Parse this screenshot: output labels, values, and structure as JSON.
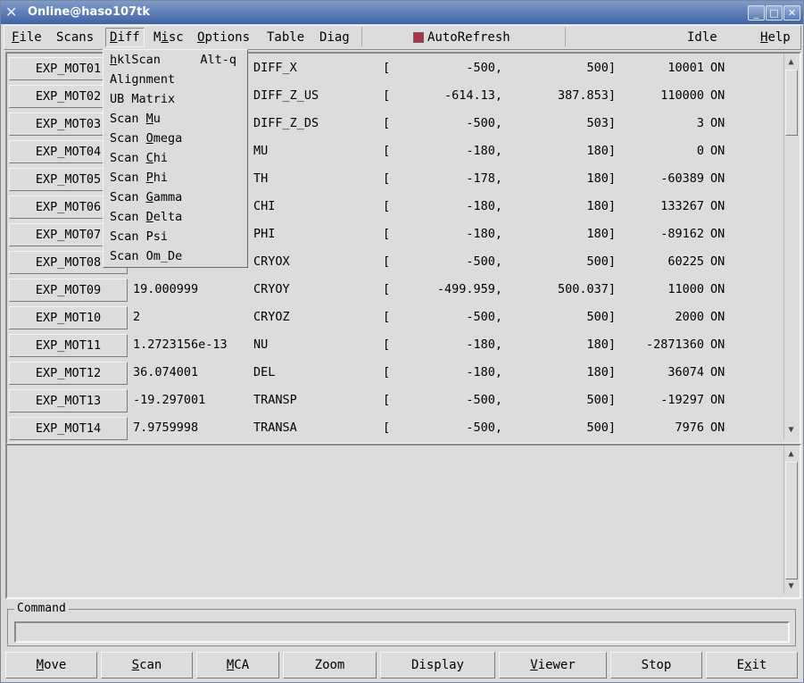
{
  "window": {
    "title": "Online@haso107tk",
    "controls": {
      "minimize": "_",
      "maximize": "□",
      "close": "✕"
    }
  },
  "menubar": {
    "items": [
      "File",
      "Scans",
      "Diff",
      "Misc",
      "Options",
      "Table",
      "Diag"
    ],
    "autorefresh_label": "AutoRefresh",
    "status": "Idle",
    "help": "Help"
  },
  "diff_menu": {
    "items": [
      {
        "label": "hklScan",
        "accel": "Alt-q"
      },
      {
        "label": "Alignment",
        "accel": ""
      },
      {
        "label": "UB Matrix",
        "accel": ""
      },
      {
        "label": "Scan Mu",
        "accel": ""
      },
      {
        "label": "Scan Omega",
        "accel": ""
      },
      {
        "label": "Scan Chi",
        "accel": ""
      },
      {
        "label": "Scan Phi",
        "accel": ""
      },
      {
        "label": "Scan Gamma",
        "accel": ""
      },
      {
        "label": "Scan Delta",
        "accel": ""
      },
      {
        "label": "Scan Psi",
        "accel": ""
      },
      {
        "label": "Scan Om_De",
        "accel": ""
      }
    ]
  },
  "motors": [
    {
      "name": "EXP_MOT01",
      "position": "",
      "alias": "DIFF_X",
      "bracket": "[",
      "min": "-500,",
      "max": "500]",
      "steps": "10001",
      "state": "ON"
    },
    {
      "name": "EXP_MOT02",
      "position": "",
      "alias": "DIFF_Z_US",
      "bracket": "[",
      "min": "-614.13,",
      "max": "387.853]",
      "steps": "110000",
      "state": "ON"
    },
    {
      "name": "EXP_MOT03",
      "position": "",
      "alias": "DIFF_Z_DS",
      "bracket": "[",
      "min": "-500,",
      "max": "503]",
      "steps": "3",
      "state": "ON"
    },
    {
      "name": "EXP_MOT04",
      "position": "",
      "alias": "MU",
      "bracket": "[",
      "min": "-180,",
      "max": "180]",
      "steps": "0",
      "state": "ON"
    },
    {
      "name": "EXP_MOT05",
      "position": "",
      "alias": "TH",
      "bracket": "[",
      "min": "-178,",
      "max": "180]",
      "steps": "-60389",
      "state": "ON"
    },
    {
      "name": "EXP_MOT06",
      "position": "",
      "alias": "CHI",
      "bracket": "[",
      "min": "-180,",
      "max": "180]",
      "steps": "133267",
      "state": "ON"
    },
    {
      "name": "EXP_MOT07",
      "position": "",
      "alias": "PHI",
      "bracket": "[",
      "min": "-180,",
      "max": "180]",
      "steps": "-89162",
      "state": "ON"
    },
    {
      "name": "EXP_MOT08",
      "position": "",
      "alias": "CRYOX",
      "bracket": "[",
      "min": "-500,",
      "max": "500]",
      "steps": "60225",
      "state": "ON"
    },
    {
      "name": "EXP_MOT09",
      "position": "19.000999",
      "alias": "CRYOY",
      "bracket": "[",
      "min": "-499.959,",
      "max": "500.037]",
      "steps": "11000",
      "state": "ON"
    },
    {
      "name": "EXP_MOT10",
      "position": "2",
      "alias": "CRYOZ",
      "bracket": "[",
      "min": "-500,",
      "max": "500]",
      "steps": "2000",
      "state": "ON"
    },
    {
      "name": "EXP_MOT11",
      "position": "1.2723156e-13",
      "alias": "NU",
      "bracket": "[",
      "min": "-180,",
      "max": "180]",
      "steps": "-2871360",
      "state": "ON"
    },
    {
      "name": "EXP_MOT12",
      "position": "36.074001",
      "alias": "DEL",
      "bracket": "[",
      "min": "-180,",
      "max": "180]",
      "steps": "36074",
      "state": "ON"
    },
    {
      "name": "EXP_MOT13",
      "position": "-19.297001",
      "alias": "TRANSP",
      "bracket": "[",
      "min": "-500,",
      "max": "500]",
      "steps": "-19297",
      "state": "ON"
    },
    {
      "name": "EXP_MOT14",
      "position": "7.9759998",
      "alias": "TRANSA",
      "bracket": "[",
      "min": "-500,",
      "max": "500]",
      "steps": "7976",
      "state": "ON"
    }
  ],
  "command": {
    "label": "Command",
    "value": ""
  },
  "buttons": [
    "Move",
    "Scan",
    "MCA",
    "Zoom",
    "Display",
    "Viewer",
    "Stop",
    "Exit"
  ],
  "colors": {
    "titlebar": "#3f63a6",
    "autorefresh_indicator": "#b0304a",
    "background": "#dcdcdc"
  }
}
